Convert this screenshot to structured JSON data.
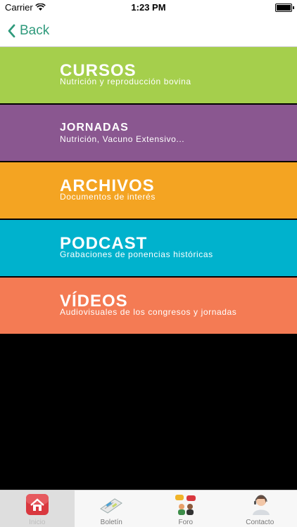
{
  "status": {
    "carrier": "Carrier",
    "time": "1:23 PM"
  },
  "nav": {
    "back_label": "Back"
  },
  "menu": [
    {
      "title": "CURSOS",
      "subtitle": "Nutrición y reproducción bovina",
      "color": "#a5cf4c"
    },
    {
      "title": "JORNADAS",
      "subtitle": "Nutrición, Vacuno Extensivo...",
      "color": "#8a5790"
    },
    {
      "title": "ARCHIVOS",
      "subtitle": "Documentos de interés",
      "color": "#f4a422"
    },
    {
      "title": "PODCAST",
      "subtitle": "Grabaciones de ponencias históricas",
      "color": "#00b2cd"
    },
    {
      "title": "VÍDEOS",
      "subtitle": "Audiovisuales de los congresos y jornadas",
      "color": "#f47b54"
    }
  ],
  "tabs": [
    {
      "label": "Inicio",
      "icon": "home-icon",
      "active": true
    },
    {
      "label": "Boletín",
      "icon": "newsletter-icon"
    },
    {
      "label": "Foro",
      "icon": "forum-icon"
    },
    {
      "label": "Contacto",
      "icon": "contact-icon"
    }
  ]
}
